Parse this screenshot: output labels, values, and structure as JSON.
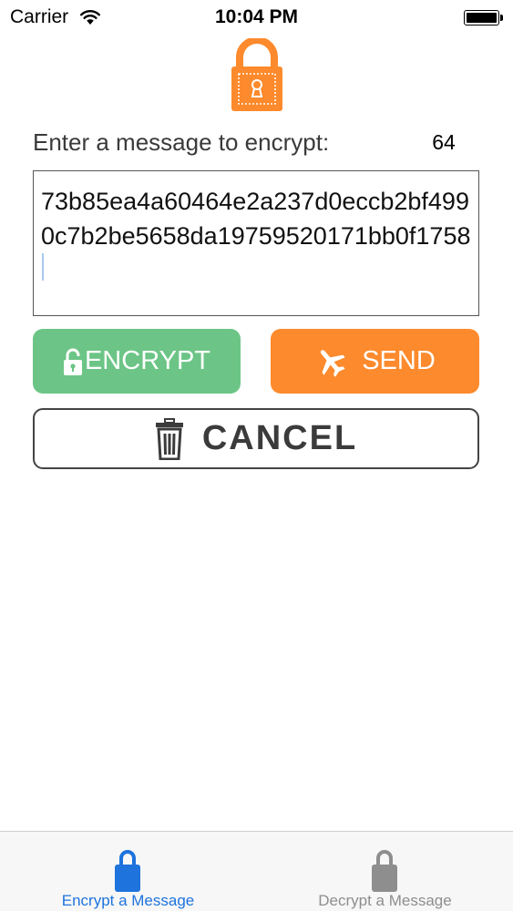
{
  "status_bar": {
    "carrier": "Carrier",
    "time": "10:04 PM"
  },
  "icons": {
    "logo": "orange-padlock-icon",
    "wifi": "wifi-icon",
    "battery": "battery-full-icon",
    "encrypt": "unlocked-padlock-icon",
    "send": "airplane-icon",
    "cancel": "trash-can-icon",
    "tab_encrypt": "padlock-icon",
    "tab_decrypt": "padlock-icon"
  },
  "colors": {
    "brand_orange": "#fd8a2c",
    "encrypt_green": "#6cc586",
    "tab_active": "#1e73dd",
    "tab_inactive": "#8e8e8e"
  },
  "form": {
    "label": "Enter a message to encrypt:",
    "char_count": "64",
    "message": "73b85ea4a60464e2a237d0eccb2bf4990c7b2be5658da19759520171bb0f1758"
  },
  "buttons": {
    "encrypt": "ENCRYPT",
    "send": "SEND",
    "cancel": "CANCEL"
  },
  "tabs": [
    {
      "label": "Encrypt a Message",
      "active": true
    },
    {
      "label": "Decrypt a Message",
      "active": false
    }
  ]
}
